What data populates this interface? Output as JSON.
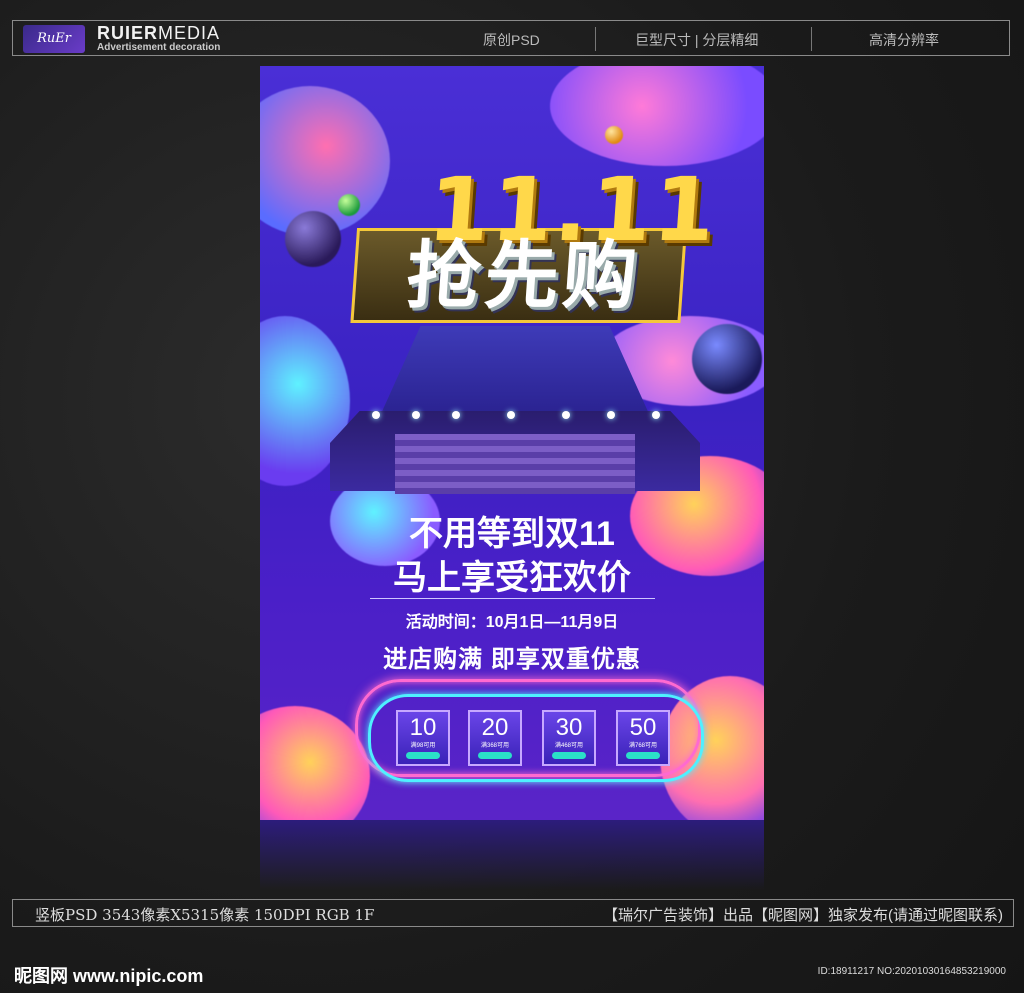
{
  "header": {
    "logo_text": "RuEr",
    "brand_name_bold": "RUIER",
    "brand_name_thin": "MEDIA",
    "brand_subtitle": "Advertisement decoration",
    "links": [
      "原创PSD",
      "巨型尺寸 | 分层精细",
      "高清分辨率"
    ]
  },
  "poster": {
    "title_number": "11.11",
    "title_cn": "抢先购",
    "headline_1": "不用等到双11",
    "headline_2": "马上享受狂欢价",
    "event_time": "活动时间：10月1日—11月9日",
    "promo": "进店购满 即享双重优惠",
    "coupons": [
      {
        "amount": "10",
        "condition": "满98可用"
      },
      {
        "amount": "20",
        "condition": "满368可用"
      },
      {
        "amount": "30",
        "condition": "满468可用"
      },
      {
        "amount": "50",
        "condition": "满768可用"
      }
    ]
  },
  "footer": {
    "spec": "竖板PSD 3543像素X5315像素 150DPI RGB 1F",
    "credit": "【瑞尔广告装饰】出品【昵图网】独家发布(请通过昵图联系)",
    "site": "昵图网 www.nipic.com",
    "id_line": "ID:18911217 NO:20201030164853219000"
  },
  "colors": {
    "poster_bg": "#3a22c2",
    "gold": "#ffd84a",
    "neon_pink": "#ff6ad0",
    "neon_cyan": "#4ff0ff"
  }
}
